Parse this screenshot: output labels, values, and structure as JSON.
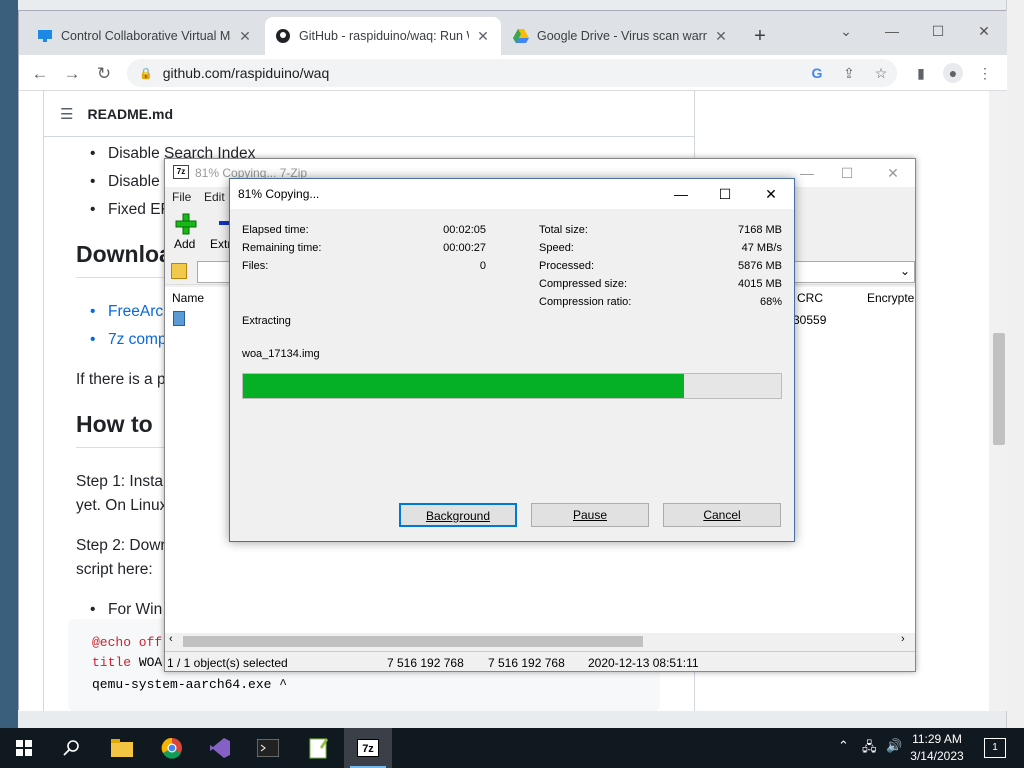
{
  "browser": {
    "tabs": [
      {
        "label": "Control Collaborative Virtual Ma",
        "icon": "monitor-icon"
      },
      {
        "label": "GitHub - raspiduino/waq: Run W",
        "icon": "github-icon"
      },
      {
        "label": "Google Drive - Virus scan warnin",
        "icon": "drive-icon"
      }
    ],
    "new_tab": "+",
    "url": "github.com/raspiduino/waq",
    "controls": {
      "minimize": "—",
      "maximize": "☐",
      "close": "✕",
      "tab_search": "⌄"
    }
  },
  "readme": {
    "filename": "README.md",
    "bullets_top": [
      "Disable Search Index",
      "Disable",
      "Fixed EF"
    ],
    "heading_download": "Downloa",
    "download_links": [
      "FreeArc",
      "7z comp"
    ],
    "if_text": "If there is a p",
    "heading_howto": "How to",
    "step1": "Step 1: Instal",
    "step1_cont": "yet. On Linux",
    "step2": "Step 2: Dowr",
    "step2_cont": "script here:",
    "for_win": "For Win",
    "code": {
      "line1_kw": "@echo off",
      "line2_kw": "title",
      "line2_rest": " WOA",
      "line3": "qemu-system-aarch64.exe ^"
    }
  },
  "zip": {
    "title": "81% Copying... 7-Zip",
    "logo": "7z",
    "menu": [
      "File",
      "Edit"
    ],
    "tools": [
      "Add",
      "Extr"
    ],
    "columns": [
      "Name",
      "CRC",
      "Encrypte"
    ],
    "row_crc": "30559",
    "status": {
      "selected": "1 / 1 object(s) selected",
      "size": "7 516 192 768",
      "packed": "7 516 192 768",
      "modified": "2020-12-13 08:51:11"
    }
  },
  "dialog": {
    "title": "81% Copying...",
    "left_labels": [
      "Elapsed time:",
      "Remaining time:",
      "Files:"
    ],
    "left_values": [
      "00:02:05",
      "00:00:27",
      "0"
    ],
    "right_labels": [
      "Total size:",
      "Speed:",
      "Processed:",
      "Compressed size:",
      "Compression ratio:"
    ],
    "right_values": [
      "7168 MB",
      "47 MB/s",
      "5876 MB",
      "4015 MB",
      "68%"
    ],
    "operation": "Extracting",
    "filename": "woa_17134.img",
    "progress": 0.82,
    "buttons": {
      "background": "Background",
      "pause": "Pause",
      "cancel": "Cancel"
    }
  },
  "taskbar": {
    "time": "11:29 AM",
    "date": "3/14/2023",
    "notifications": "1",
    "apps": [
      "windows-start-icon",
      "search-icon",
      "file-explorer-icon",
      "chrome-icon",
      "visual-studio-icon",
      "terminal-icon",
      "notepad-plus-icon",
      "7zip-icon"
    ],
    "seven_zip_label": "7z"
  },
  "colors": {
    "progress": "#06b025",
    "link": "#0969da",
    "taskbar": "#101820"
  }
}
